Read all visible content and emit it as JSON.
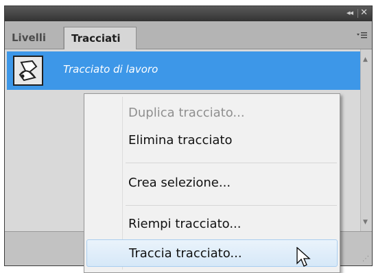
{
  "panel": {
    "titlebar": {
      "collapse_glyph": "◂◂",
      "close_glyph": "✕"
    },
    "tabs": [
      {
        "label": "Livelli",
        "active": false
      },
      {
        "label": "Tracciati",
        "active": true
      }
    ],
    "menu_icon": "panel-menu-icon",
    "paths": [
      {
        "name": "Tracciato di lavoro",
        "selected": true
      }
    ]
  },
  "context_menu": {
    "items": [
      {
        "label": "Duplica tracciato...",
        "enabled": false
      },
      {
        "label": "Elimina tracciato",
        "enabled": true
      },
      {
        "label": "Crea selezione...",
        "enabled": true
      },
      {
        "label": "Riempi tracciato...",
        "enabled": true
      },
      {
        "label": "Traccia tracciato...",
        "enabled": true,
        "hovered": true
      }
    ]
  },
  "colors": {
    "selection": "#3d97e8",
    "menu_hover": "#d6e8f8"
  }
}
